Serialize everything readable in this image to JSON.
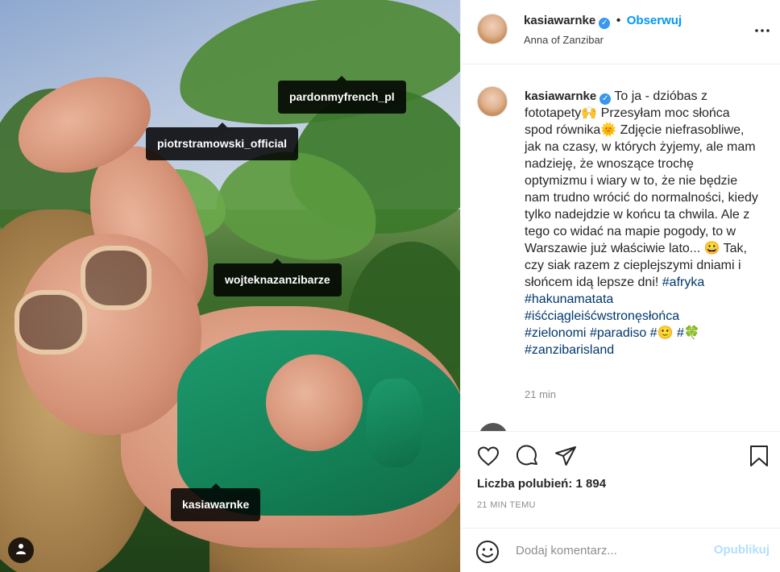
{
  "photo": {
    "tags": [
      {
        "name": "tag-pardonmyfrench",
        "label": "pardonmyfrench_pl"
      },
      {
        "name": "tag-piotrstramowski",
        "label": "piotrstramowski_official"
      },
      {
        "name": "tag-wojteknazanzibarze",
        "label": "wojteknazanzibarze"
      },
      {
        "name": "tag-kasiawarnke",
        "label": "kasiawarnke"
      }
    ],
    "user_icon": "user-icon"
  },
  "header": {
    "username": "kasiawarnke",
    "verified_glyph": "✓",
    "follow_label": "Obserwuj",
    "location": "Anna of Zanzibar",
    "more_icon": "more-options-icon"
  },
  "caption": {
    "username": "kasiawarnke",
    "verified_glyph": "✓",
    "text_1": "To ja - dzióbas z fototapety",
    "emoji_1": "🙌",
    "text_2": " Przesyłam moc słońca spod równika",
    "emoji_2": "🌞",
    "text_3": " Zdjęcie niefrasobliwe, jak na czasy, w których żyjemy, ale mam nadzieję, że wnoszące trochę optymizmu i wiary w to, że nie będzie nam trudno wrócić do normalności, kiedy tylko nadejdzie w końcu ta chwila. Ale z tego co widać na mapie pogody, to w Warszawie już właściwie lato... ",
    "emoji_3": "😀",
    "text_4": " Tak, czy siak razem z cieplejszymi dniami i słońcem idą lepsze dni! ",
    "hashtags_1": [
      "#afryka",
      "#hakunamatata",
      "#iśćciągleiśćwstronęsłońca",
      "#zielonomi",
      "#paradiso"
    ],
    "hash_prefix": "#",
    "emoji_4": "🙂",
    "emoji_5": "🍀",
    "hashtag_last": "#zanzibarisland",
    "time": "21 min"
  },
  "actions": {
    "likes": "Liczba polubień: 1 894",
    "ago": "21 MIN TEMU"
  },
  "comment": {
    "placeholder": "Dodaj komentarz...",
    "post_label": "Opublikuj"
  },
  "colors": {
    "accent": "#0095f6",
    "hashtag": "#00376b",
    "muted": "#8e8e8e",
    "post_disabled": "#b2dffc",
    "verified": "#3897f0"
  }
}
